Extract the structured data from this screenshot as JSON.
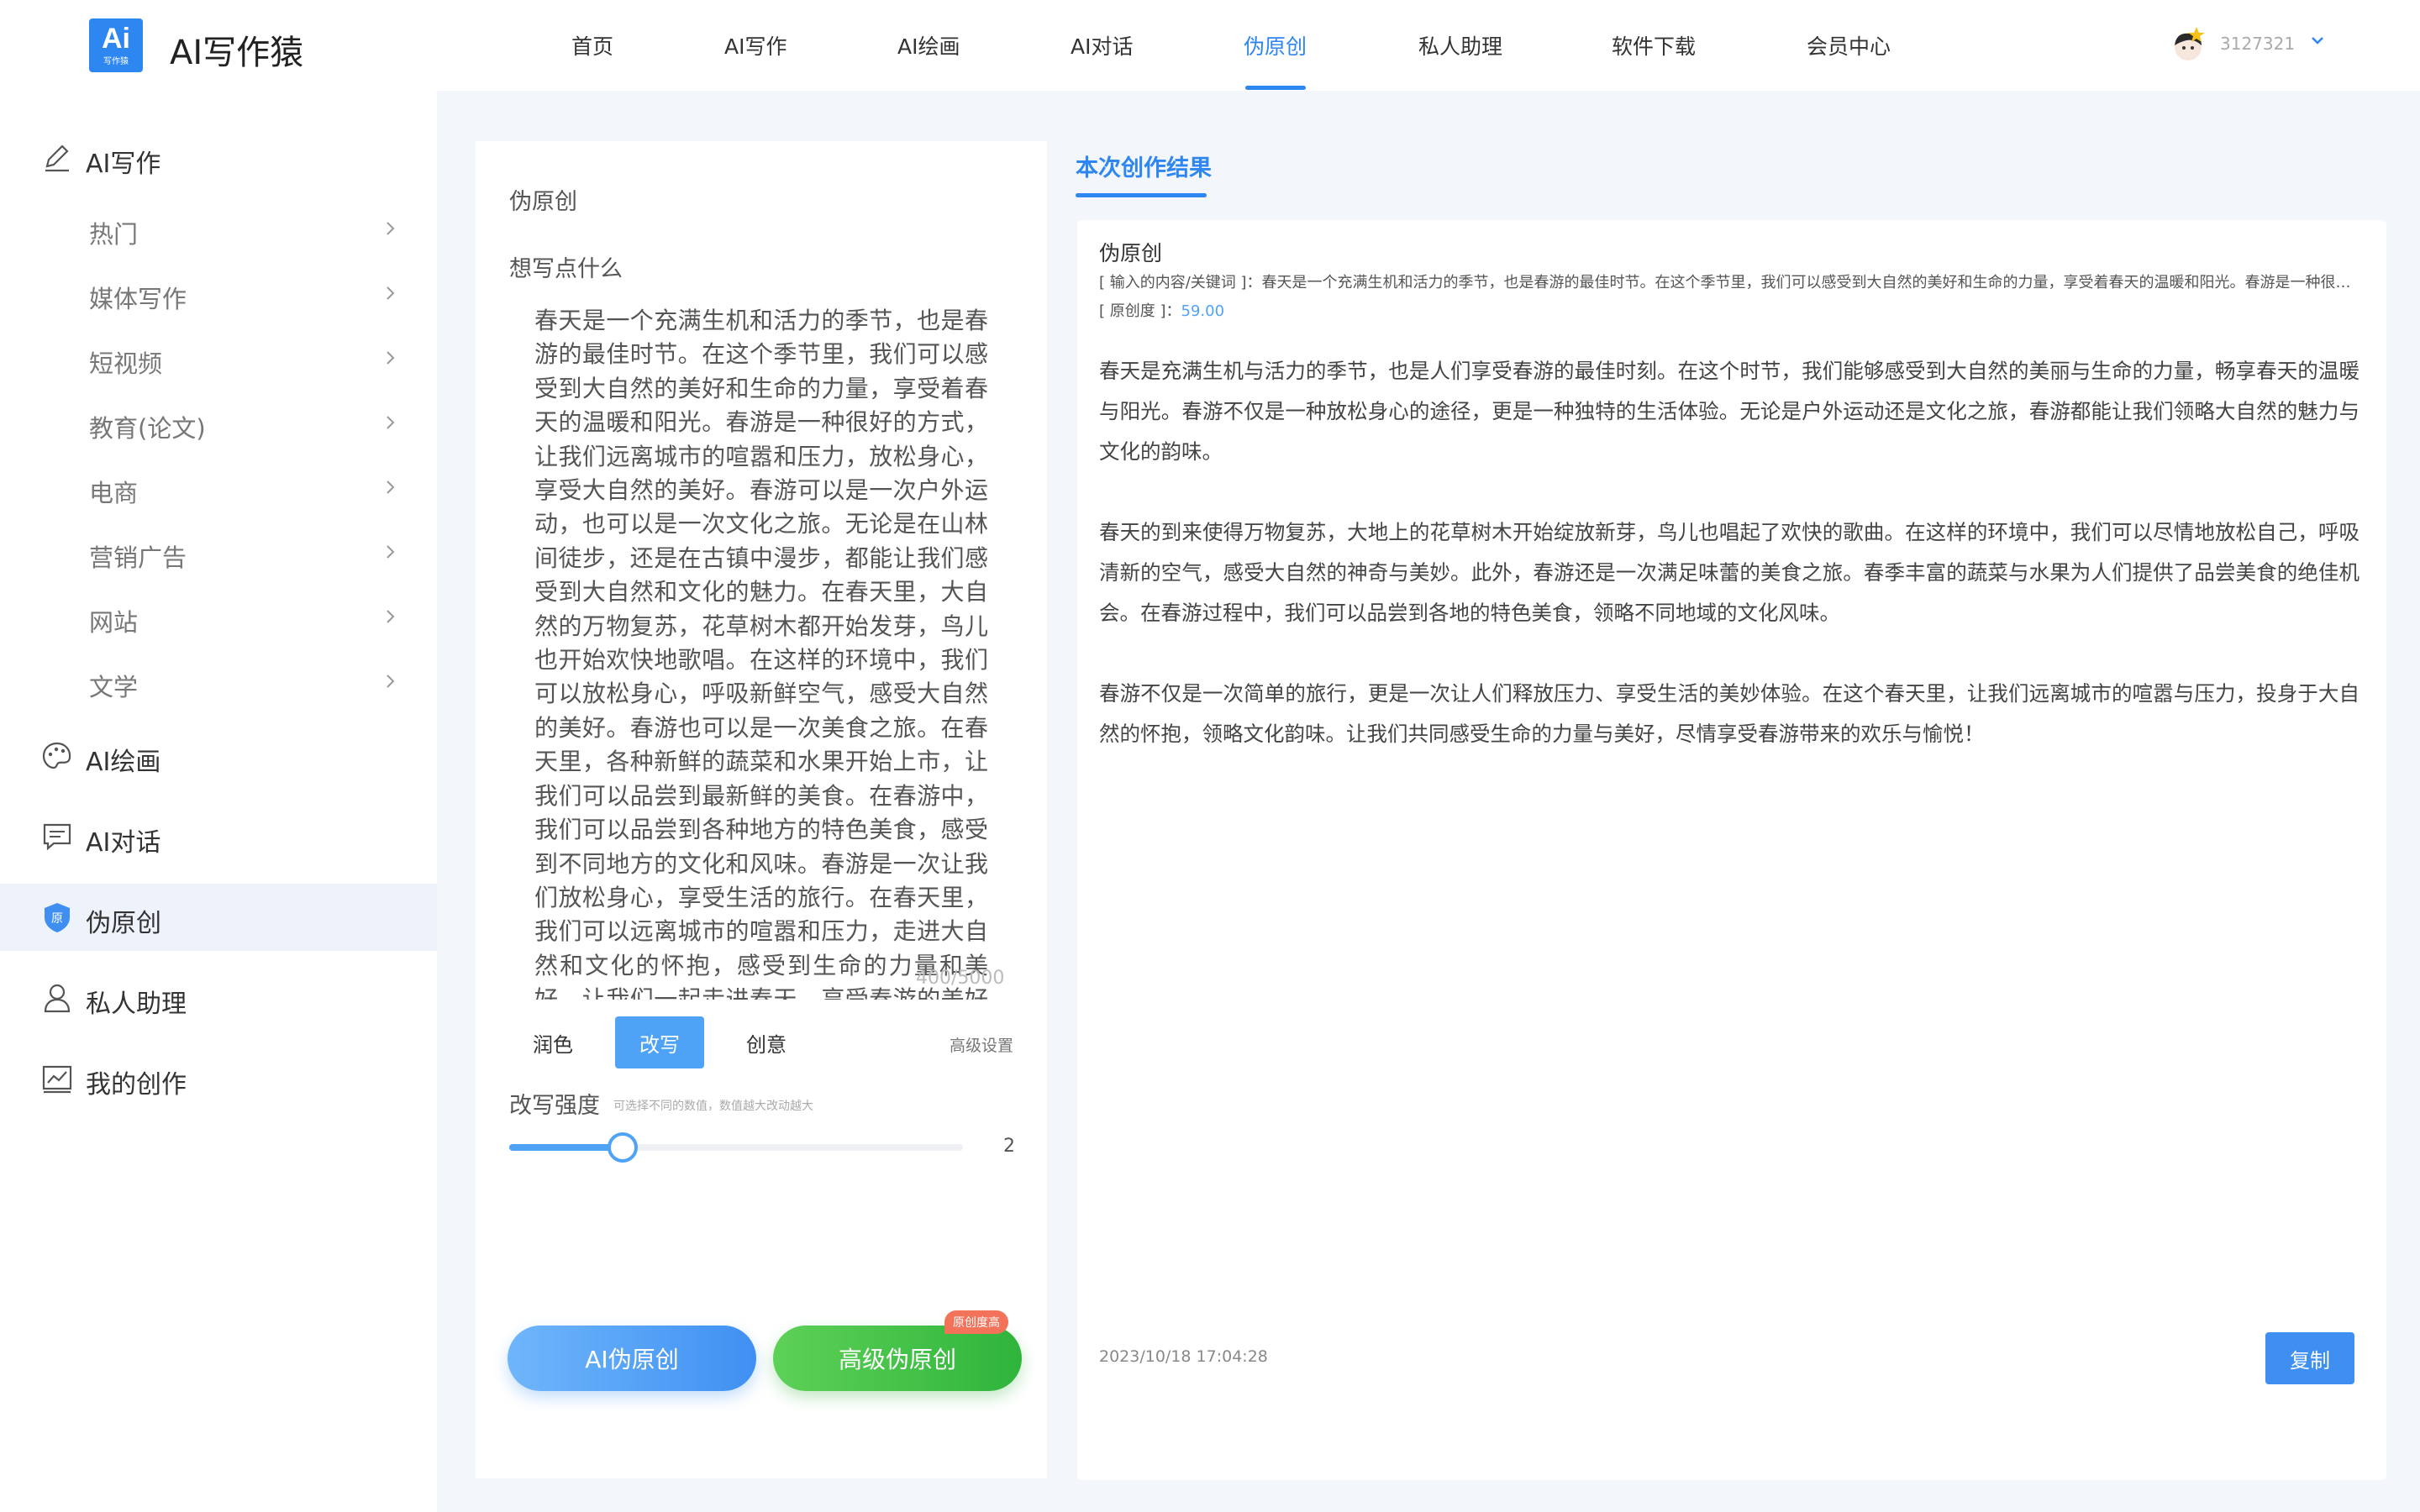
{
  "header": {
    "logo_text": "Ai",
    "logo_sub": "写作猿",
    "app_title": "AI写作猿",
    "nav": [
      {
        "label": "首页"
      },
      {
        "label": "AI写作"
      },
      {
        "label": "AI绘画"
      },
      {
        "label": "AI对话"
      },
      {
        "label": "伪原创"
      },
      {
        "label": "私人助理"
      },
      {
        "label": "软件下载"
      },
      {
        "label": "会员中心"
      }
    ],
    "active_nav": "伪原创",
    "username": "3127321"
  },
  "sidebar": {
    "writing": {
      "label": "AI写作",
      "subitems": [
        {
          "label": "热门"
        },
        {
          "label": "媒体写作"
        },
        {
          "label": "短视频"
        },
        {
          "label": "教育(论文)"
        },
        {
          "label": "电商"
        },
        {
          "label": "营销广告"
        },
        {
          "label": "网站"
        },
        {
          "label": "文学"
        }
      ]
    },
    "groups": [
      {
        "label": "AI绘画",
        "icon": "palette-icon"
      },
      {
        "label": "AI对话",
        "icon": "chat-icon"
      },
      {
        "label": "伪原创",
        "icon": "shield-icon"
      },
      {
        "label": "私人助理",
        "icon": "user-icon"
      },
      {
        "label": "我的创作",
        "icon": "chart-icon"
      }
    ],
    "shield_glyph": "原"
  },
  "form": {
    "section_title": "伪原创",
    "input_label": "想写点什么",
    "input_text": "春天是一个充满生机和活力的季节，也是春游的最佳时节。在这个季节里，我们可以感受到大自然的美好和生命的力量，享受着春天的温暖和阳光。春游是一种很好的方式，让我们远离城市的喧嚣和压力，放松身心，享受大自然的美好。春游可以是一次户外运动，也可以是一次文化之旅。无论是在山林间徒步，还是在古镇中漫步，都能让我们感受到大自然和文化的魅力。在春天里，大自然的万物复苏，花草树木都开始发芽，鸟儿也开始欢快地歌唱。在这样的环境中，我们可以放松身心，呼吸新鲜空气，感受大自然的美好。春游也可以是一次美食之旅。在春天里，各种新鲜的蔬菜和水果开始上市，让我们可以品尝到最新鲜的美食。在春游中，我们可以品尝到各种地方的特色美食，感受到不同地方的文化和风味。春游是一次让我们放松身心，享受生活的旅行。在春天里，我们可以远离城市的喧嚣和压力，走进大自然和文化的怀抱，感受到生命的力量和美好。让我们一起走进春天，享受春游的美好吧！",
    "counter": "400/5000",
    "modes": [
      {
        "label": "润色"
      },
      {
        "label": "改写"
      },
      {
        "label": "创意"
      }
    ],
    "active_mode": "改写",
    "advanced_link": "高级设置",
    "strength_label": "改写强度",
    "strength_hint": "可选择不同的数值，数值越大改动越大",
    "strength_value": "2",
    "strength_fraction": 0.25,
    "btn_primary": "AI伪原创",
    "btn_advanced": "高级伪原创",
    "badge": "原创度高"
  },
  "result": {
    "tab_label": "本次创作结果",
    "title": "伪原创",
    "meta": "[ 输入的内容/关键词 ]：春天是一个充满生机和活力的季节，也是春游的最佳时节。在这个季节里，我们可以感受到大自然的美好和生命的力量，享受着春天的温暖和阳光。春游是一种很好的方式，让我们远离城市的喧嚣和压力，放松身心，享受大自然的美好。",
    "score_label": "[ 原创度 ]：",
    "score_value": "59.00",
    "paragraphs": [
      "春天是充满生机与活力的季节，也是人们享受春游的最佳时刻。在这个时节，我们能够感受到大自然的美丽与生命的力量，畅享春天的温暖与阳光。春游不仅是一种放松身心的途径，更是一种独特的生活体验。无论是户外运动还是文化之旅，春游都能让我们领略大自然的魅力与文化的韵味。",
      "春天的到来使得万物复苏，大地上的花草树木开始绽放新芽，鸟儿也唱起了欢快的歌曲。在这样的环境中，我们可以尽情地放松自己，呼吸清新的空气，感受大自然的神奇与美妙。此外，春游还是一次满足味蕾的美食之旅。春季丰富的蔬菜与水果为人们提供了品尝美食的绝佳机会。在春游过程中，我们可以品尝到各地的特色美食，领略不同地域的文化风味。",
      "春游不仅是一次简单的旅行，更是一次让人们释放压力、享受生活的美妙体验。在这个春天里，让我们远离城市的喧嚣与压力，投身于大自然的怀抱，领略文化韵味。让我们共同感受生命的力量与美好，尽情享受春游带来的欢乐与愉悦！"
    ],
    "timestamp": "2023/10/18 17:04:28",
    "copy_label": "复制"
  },
  "colors": {
    "accent": "#2e86f0",
    "primary_button": "#4fa3f7",
    "green_button": "#3cbf45",
    "badge": "#f2735a"
  }
}
